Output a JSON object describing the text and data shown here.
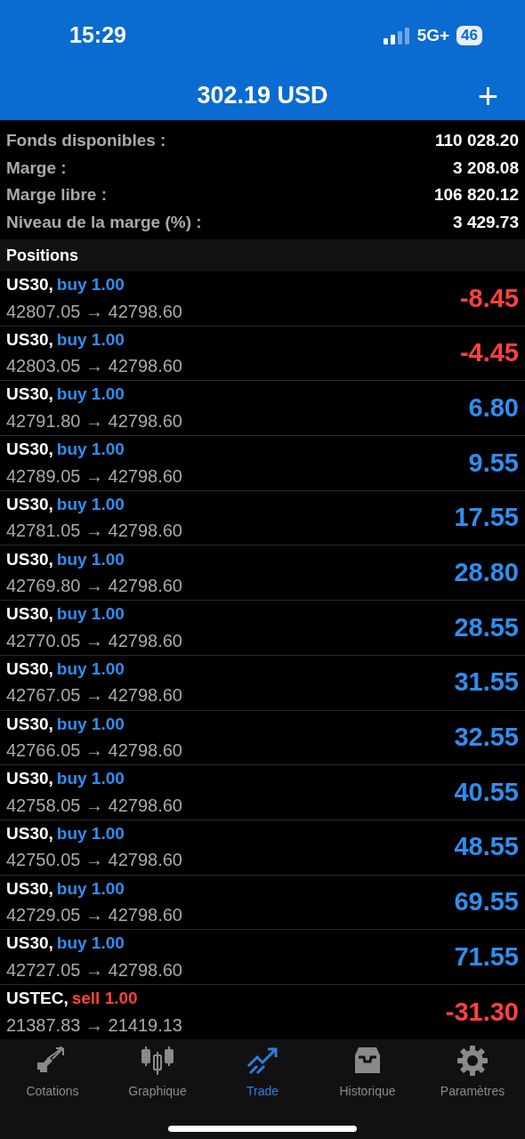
{
  "status_bar": {
    "time": "15:29",
    "network": "5G+",
    "battery": "46"
  },
  "header": {
    "title": "302.19 USD",
    "add_button": "+"
  },
  "summary": [
    {
      "label": "Fonds disponibles :",
      "value": "110 028.20"
    },
    {
      "label": "Marge :",
      "value": "3 208.08"
    },
    {
      "label": "Marge libre :",
      "value": "106 820.12"
    },
    {
      "label": "Niveau de la marge (%) :",
      "value": "3 429.73"
    }
  ],
  "positions_title": "Positions",
  "positions": [
    {
      "symbol": "US30,",
      "kind": "buy",
      "order": "buy 1.00",
      "prices": "42807.05 → 42798.60",
      "profit": "-8.45",
      "loss": true
    },
    {
      "symbol": "US30,",
      "kind": "buy",
      "order": "buy 1.00",
      "prices": "42803.05 → 42798.60",
      "profit": "-4.45",
      "loss": true
    },
    {
      "symbol": "US30,",
      "kind": "buy",
      "order": "buy 1.00",
      "prices": "42791.80 → 42798.60",
      "profit": "6.80",
      "loss": false
    },
    {
      "symbol": "US30,",
      "kind": "buy",
      "order": "buy 1.00",
      "prices": "42789.05 → 42798.60",
      "profit": "9.55",
      "loss": false
    },
    {
      "symbol": "US30,",
      "kind": "buy",
      "order": "buy 1.00",
      "prices": "42781.05 → 42798.60",
      "profit": "17.55",
      "loss": false
    },
    {
      "symbol": "US30,",
      "kind": "buy",
      "order": "buy 1.00",
      "prices": "42769.80 → 42798.60",
      "profit": "28.80",
      "loss": false
    },
    {
      "symbol": "US30,",
      "kind": "buy",
      "order": "buy 1.00",
      "prices": "42770.05 → 42798.60",
      "profit": "28.55",
      "loss": false
    },
    {
      "symbol": "US30,",
      "kind": "buy",
      "order": "buy 1.00",
      "prices": "42767.05 → 42798.60",
      "profit": "31.55",
      "loss": false
    },
    {
      "symbol": "US30,",
      "kind": "buy",
      "order": "buy 1.00",
      "prices": "42766.05 → 42798.60",
      "profit": "32.55",
      "loss": false
    },
    {
      "symbol": "US30,",
      "kind": "buy",
      "order": "buy 1.00",
      "prices": "42758.05 → 42798.60",
      "profit": "40.55",
      "loss": false
    },
    {
      "symbol": "US30,",
      "kind": "buy",
      "order": "buy 1.00",
      "prices": "42750.05 → 42798.60",
      "profit": "48.55",
      "loss": false
    },
    {
      "symbol": "US30,",
      "kind": "buy",
      "order": "buy 1.00",
      "prices": "42729.05 → 42798.60",
      "profit": "69.55",
      "loss": false
    },
    {
      "symbol": "US30,",
      "kind": "buy",
      "order": "buy 1.00",
      "prices": "42727.05 → 42798.60",
      "profit": "71.55",
      "loss": false
    },
    {
      "symbol": "USTEC,",
      "kind": "sell",
      "order": "sell 1.00",
      "prices": "21387.83 → 21419.13",
      "profit": "-31.30",
      "loss": true
    }
  ],
  "tabs": [
    {
      "label": "Cotations",
      "kind": "quotes",
      "selected": false
    },
    {
      "label": "Graphique",
      "kind": "chart",
      "selected": false
    },
    {
      "label": "Trade",
      "kind": "trade",
      "selected": true
    },
    {
      "label": "Historique",
      "kind": "history",
      "selected": false
    },
    {
      "label": "Paramètres",
      "kind": "settings",
      "selected": false
    }
  ]
}
